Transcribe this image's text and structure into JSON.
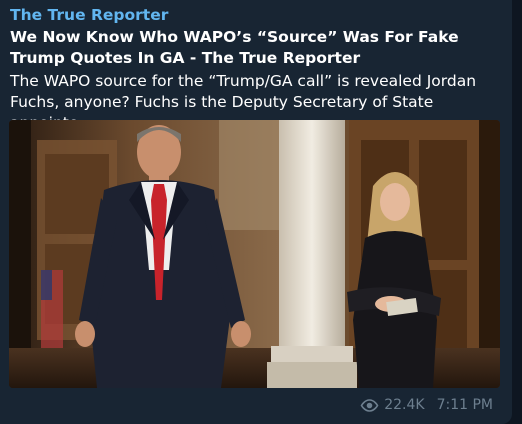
{
  "message": {
    "channel_name": "The True Reporter",
    "link_title": "We Now Know Who WAPO’s “Source” Was For Fake Trump Quotes In GA - The True Reporter",
    "link_description": "The WAPO source for the “Trump/GA call” is revealed Jordan\nFuchs, anyone? Fuchs is the Deputy Secretary of State appointe...",
    "views": "22.4K",
    "time": "7:11 PM"
  },
  "colors": {
    "background": "#0e1621",
    "bubble": "#182533",
    "channel_name": "#62b6f0",
    "meta_text": "#6d7f8f"
  },
  "icons": {
    "views": "eye-icon"
  }
}
